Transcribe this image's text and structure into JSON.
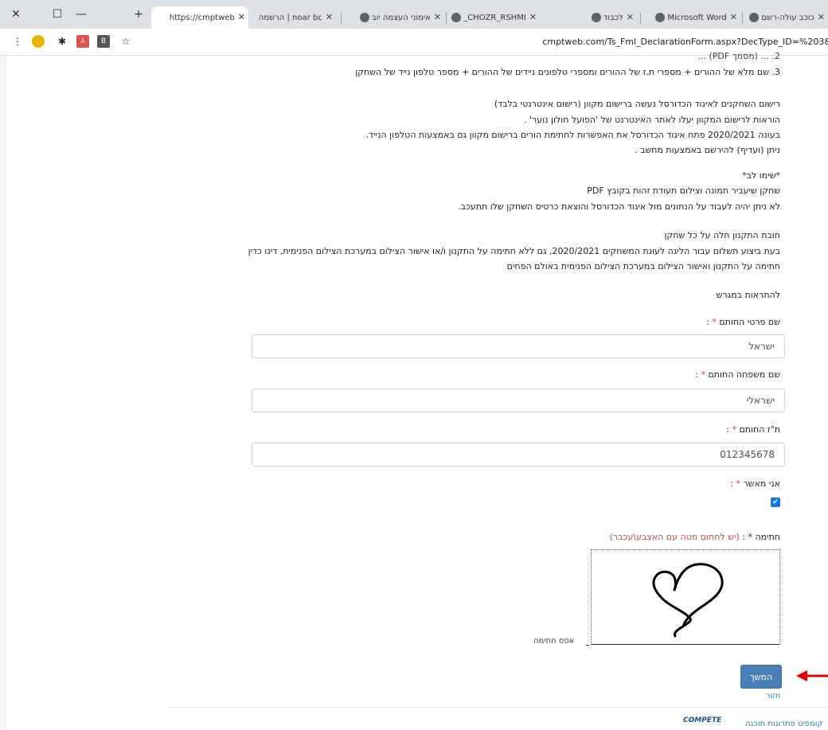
{
  "browser": {
    "tabs": [
      {
        "label": "https://cmptweb"
      },
      {
        "label": "noar bc | הרשמה"
      },
      {
        "label": "אימוני העצמה יוב"
      },
      {
        "label": "CHOZR_RSHMI_"
      },
      {
        "label": "לכבוד"
      },
      {
        "label": "Microsoft Word"
      },
      {
        "label": "כוכב עולה-רשם"
      }
    ],
    "new_tab": "+",
    "url": "cmptweb.com/Ts_Fml_DeclarationForm.aspx?DecType_ID=%203&"
  },
  "content": {
    "list_partial": "2. ... (מסמך PDF) ...",
    "list_item_3": "3.   שם מלא של ההורים + מספרי ת.ז של ההורים ומספרי טלפונים ניידים של ההורים + מספר טלפון נייד של השחקן",
    "para1": [
      "רישום השחקנים לאיגוד הכדורסל נעשה ברישום מקוון (רישום אינטרנטי בלבד)",
      "הוראות לרישום המקוון יעלו לאתר האינטרנט של 'הפועל חולון נוער' .",
      "בעונה 2020/2021 פתח איגוד הכדורסל את האפשרות לחתימת הורים ברישום מקוון גם באמצעות הטלפון הנייד.",
      "ניתן (ועדיף) להירשם באמצעות מחשב ."
    ],
    "para2": [
      "*שימו לב*",
      "שחקן שיעביר תמונה וצילום תעודת זהות בקובץ PDF",
      "לא ניתן יהיה לעבוד על הנתונים מול איגוד הכדורסל והוצאת כרטיס השחקן שלו תתעכב."
    ],
    "para3": [
      "חובת התקנון חלה על כל שחקן",
      "בעת ביצוע תשלום עבור הליגה לעונת המשחקים 2020/2021, גם ללא חתימה על התקנון ו/או אישור הצילום במערכת הצילום הפנימית, דינו כדין",
      "חתימה על התקנון ואישור הצילום במערכת הצילום הפנימית באולם הפחים"
    ],
    "para4": "להתראות במגרש"
  },
  "form": {
    "first_name_label": "שם פרטי החותם",
    "first_name_value": "ישראל",
    "last_name_label": "שם משפחה החותם",
    "last_name_value": "ישראלי",
    "id_label": "ת\"ז החותם",
    "id_value": "012345678",
    "approve_label": "אני מאשר",
    "required_mark": "*",
    "colon": " :",
    "signature_label": "חתימה",
    "signature_hint": "(יש לחתום מטה עם האצבע\\עכבר)",
    "clear_signature": "אפס חתימה",
    "continue_button": "המשך",
    "back_link": "חזור"
  },
  "footer": {
    "logo": "COMPETE",
    "text": "קומפיט פתרונות תוכנה"
  },
  "colors": {
    "accent": "#4a7fb5",
    "arrow": "#e00000",
    "required": "#dc3545"
  }
}
